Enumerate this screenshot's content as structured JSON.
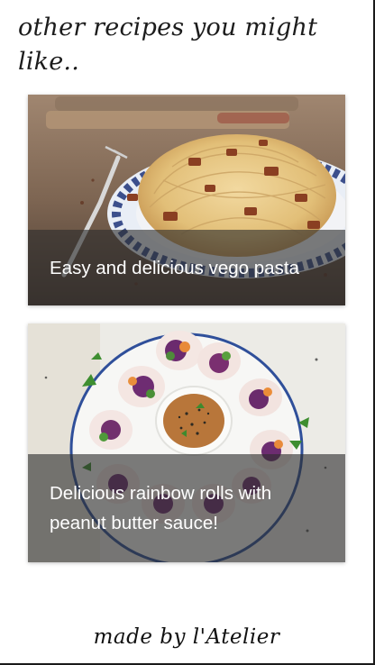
{
  "section": {
    "heading": "other recipes you might like.."
  },
  "recipes": [
    {
      "title": "Easy and delicious vego pasta",
      "image_icon": "pasta-photo"
    },
    {
      "title": "Delicious rainbow rolls with peanut butter sauce!",
      "image_icon": "rainbow-rolls-photo"
    }
  ],
  "footer": {
    "credit": "made by l'Atelier"
  }
}
